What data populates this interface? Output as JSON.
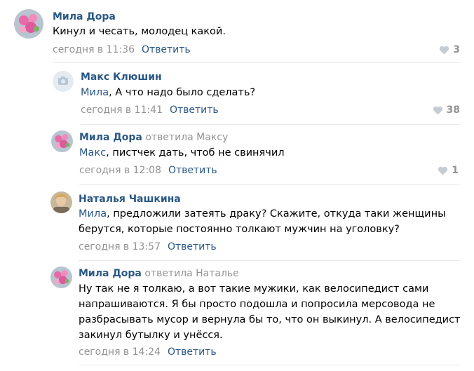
{
  "comments": [
    {
      "author": "Мила Дора",
      "replied_to": "",
      "mention": "",
      "text": "Кинул и чесать, молодец какой.",
      "date": "сегодня в 11:36",
      "reply_label": "Ответить",
      "likes": "3",
      "avatar_icon": "flowers-avatar"
    },
    {
      "author": "Макс Клюшин",
      "replied_to": "",
      "mention": "Мила",
      "text": ", А что надо было сделать?",
      "date": "сегодня в 11:41",
      "reply_label": "Ответить",
      "likes": "38",
      "avatar_icon": "camera-placeholder-avatar"
    },
    {
      "author": "Мила Дора",
      "replied_to": "ответила Максу",
      "mention": "Макс",
      "text": ", пистчек дать, чтоб не свинячил",
      "date": "сегодня в 12:08",
      "reply_label": "Ответить",
      "likes": "1",
      "avatar_icon": "flowers-avatar"
    },
    {
      "author": "Наталья Чашкина",
      "replied_to": "",
      "mention": "Мила",
      "text_lines": [
        ", предложили затеять драку? Скажите, откуда таки женщины",
        "берутся, которые постоянно толкают мужчин на уголовку?"
      ],
      "date": "сегодня в 13:57",
      "reply_label": "Ответить",
      "likes": "",
      "avatar_icon": "photo-avatar"
    },
    {
      "author": "Мила Дора",
      "replied_to": "ответила Наталье",
      "mention": "",
      "text_lines": [
        "Ну так не я толкаю, а вот такие мужики, как велосипедист сами",
        "напрашиваются. Я бы просто подошла и попросила мерсовода не",
        "разбрасывать мусор и вернула бы то, что он выкинул. А велосипедист",
        "закинул бутылку и унёсся."
      ],
      "date": "сегодня в 14:24",
      "reply_label": "Ответить",
      "likes": "",
      "avatar_icon": "flowers-avatar"
    }
  ],
  "colors": {
    "author": "#2a5885",
    "meta": "#939393",
    "divider": "#e7e8ec"
  }
}
